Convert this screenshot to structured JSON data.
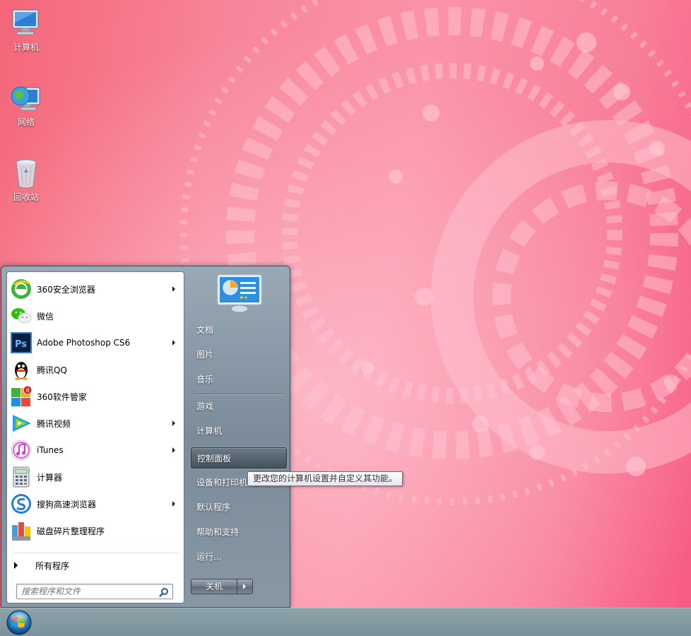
{
  "desktop": {
    "icons": [
      {
        "label": "计算机",
        "icon": "computer-icon"
      },
      {
        "label": "网络",
        "icon": "network-icon"
      },
      {
        "label": "回收站",
        "icon": "recycle-bin-icon"
      }
    ]
  },
  "start_menu": {
    "programs": [
      {
        "name": "360安全浏览器",
        "icon": "360-browser-icon",
        "has_submenu": true
      },
      {
        "name": "微信",
        "icon": "wechat-icon",
        "has_submenu": false
      },
      {
        "name": "Adobe Photoshop CS6",
        "icon": "photoshop-icon",
        "has_submenu": true
      },
      {
        "name": "腾讯QQ",
        "icon": "qq-icon",
        "has_submenu": false
      },
      {
        "name": "360软件管家",
        "icon": "360-software-manager-icon",
        "has_submenu": false
      },
      {
        "name": "腾讯视频",
        "icon": "tencent-video-icon",
        "has_submenu": true
      },
      {
        "name": "iTunes",
        "icon": "itunes-icon",
        "has_submenu": true
      },
      {
        "name": "计算器",
        "icon": "calculator-icon",
        "has_submenu": false
      },
      {
        "name": "搜狗高速浏览器",
        "icon": "sogou-browser-icon",
        "has_submenu": true
      },
      {
        "name": "磁盘碎片整理程序",
        "icon": "disk-defrag-icon",
        "has_submenu": false
      }
    ],
    "all_programs_label": "所有程序",
    "search_placeholder": "搜索程序和文件",
    "right_links": {
      "documents": "文档",
      "pictures": "图片",
      "music": "音乐",
      "games": "游戏",
      "computer": "计算机",
      "control_panel": "控制面板",
      "devices_printers": "设备和打印机",
      "default_programs": "默认程序",
      "help_support": "帮助和支持",
      "run": "运行..."
    },
    "hovered_link": "control_panel",
    "shutdown_label": "关机",
    "tooltip": "更改您的计算机设置并自定义其功能。"
  },
  "colors": {
    "wallpaper_pink": "#f87f98",
    "taskbar": "#7a9299",
    "menu_frame": "#8897a4"
  }
}
